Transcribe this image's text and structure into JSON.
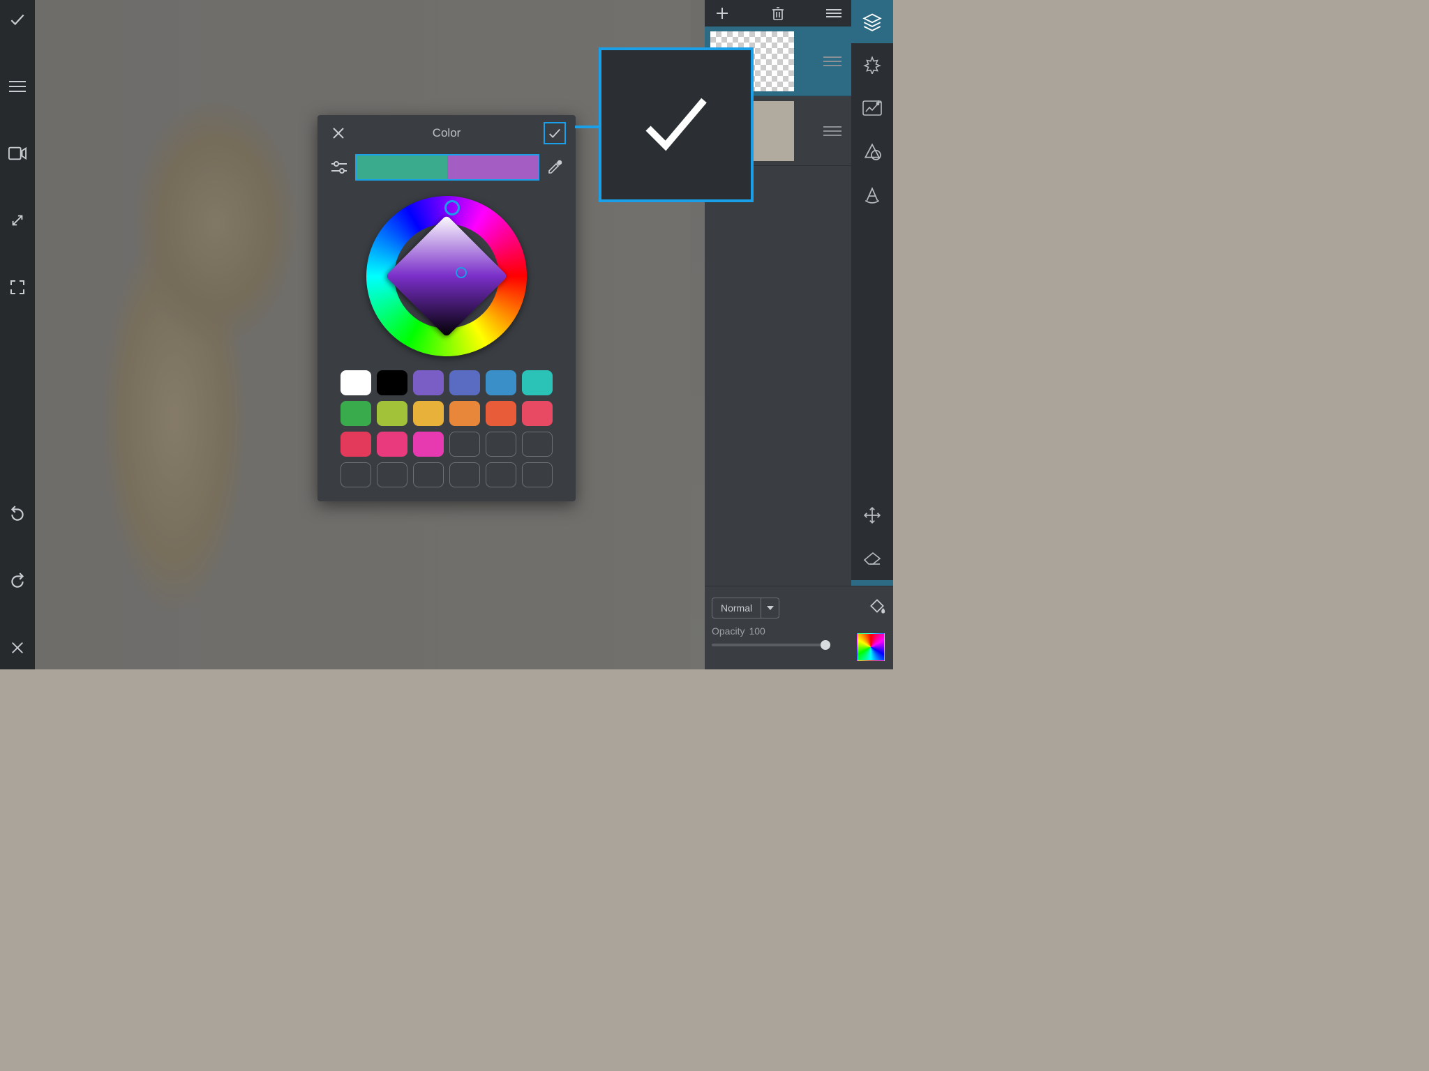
{
  "popover": {
    "title": "Color",
    "currentColor": "#3aab8c",
    "newColor": "#a45dc3"
  },
  "swatches": [
    "#ffffff",
    "#000000",
    "#7a5ec5",
    "#5a6bc2",
    "#3a8fc9",
    "#2bc2b8",
    "#3aab4c",
    "#a2c23a",
    "#e8b23a",
    "#e8863a",
    "#e85c3a",
    "#e84a64",
    "#e33a5c",
    "#e83a7d",
    "#e83ab0",
    "",
    "",
    "",
    "",
    "",
    "",
    "",
    "",
    ""
  ],
  "layers": {
    "blendMode": "Normal",
    "opacityLabel": "Opacity",
    "opacityValue": "100"
  },
  "colors": {
    "accent": "#1aa0e8"
  }
}
